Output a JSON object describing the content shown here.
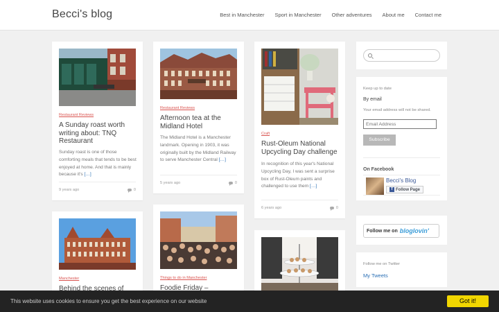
{
  "header": {
    "site_title": "Becci's blog",
    "nav": [
      "Best in Manchester",
      "Sport in Manchester",
      "Other adventures",
      "About me",
      "Contact me"
    ]
  },
  "posts": [
    {
      "category": "Restaurant Reviews",
      "title": "A Sunday roast worth writing about: TNQ Restaurant",
      "excerpt": "Sunday roast is one of those comforting meals that tends to be best enjoyed at home. And that is mainly because it's ",
      "more": "[…]",
      "date": "9 years ago",
      "comments": "0"
    },
    {
      "category": "Restaurant Reviews",
      "title": "Afternoon tea at the Midland Hotel",
      "excerpt": "The Midland Hotel is a Manchester landmark. Opening in 1903, it was originally built by the Midland Railway to serve Manchester Central ",
      "more": "[…]",
      "date": "5 years ago",
      "comments": "0"
    },
    {
      "category": "Craft",
      "title": "Rust-Oleum National Upcycling Day challenge",
      "excerpt": "In recognition of this year's National Upcycling Day, I was sent a surprise box of Rust-Oleum paints and challenged to use them ",
      "more": "[…]",
      "date": "6 years ago",
      "comments": "0"
    },
    {
      "category": "Manchester",
      "title": "Behind the scenes of"
    },
    {
      "category": "Things to do in Manchester",
      "title": "Foodie Friday –"
    }
  ],
  "sidebar": {
    "subscribe": {
      "keep_up": "Keep up to date",
      "by_email": "By email",
      "note": "Your email address will not be shared.",
      "email_placeholder": "Email Address",
      "button": "Subscribe"
    },
    "facebook": {
      "heading": "On Facebook",
      "page_name": "Becci's Blog",
      "follow_label": "Follow Page"
    },
    "bloglovin": {
      "prefix": "Follow me on",
      "brand": "bloglovin'"
    },
    "twitter": {
      "heading": "Follow me on Twitter",
      "link": "My Tweets"
    }
  },
  "cookie": {
    "text": "This website uses cookies to ensure you get the best experience on our website",
    "button": "Got it!"
  },
  "colors": {
    "category_link": "#d9534f",
    "more_link": "#2a6fb5",
    "cookie_button": "#f1d600",
    "facebook_blue": "#3b5998"
  }
}
